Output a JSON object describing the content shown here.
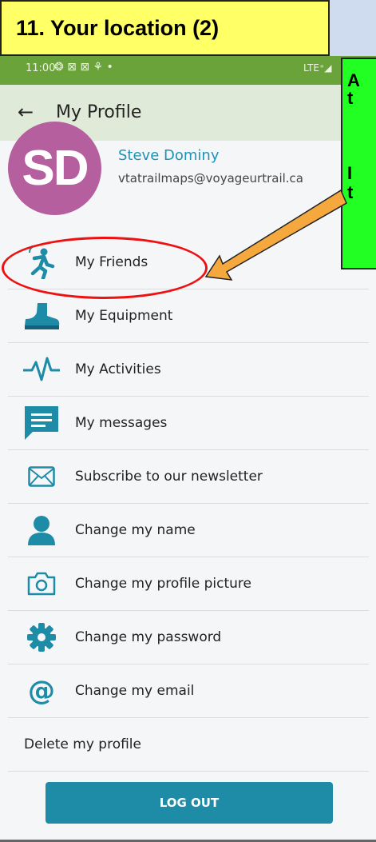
{
  "slide": {
    "title": "11. Your location (2)"
  },
  "callout": {
    "line1": "A",
    "line2": "t",
    "line3": "I",
    "line4": "t"
  },
  "status": {
    "time": "11:00",
    "icons": "❂ ⊠ ⊠ ⚘ •",
    "network": "LTE⁺◢"
  },
  "appbar": {
    "back": "←",
    "title": "My Profile"
  },
  "profile": {
    "initials": "SD",
    "name": "Steve Dominy",
    "email": "vtatrailmaps@voyageurtrail.ca"
  },
  "menu": [
    {
      "label": "My Friends",
      "icon": "runner-icon"
    },
    {
      "label": "My Equipment",
      "icon": "boot-icon"
    },
    {
      "label": "My Activities",
      "icon": "pulse-icon"
    },
    {
      "label": "My messages",
      "icon": "message-icon"
    },
    {
      "label": "Subscribe to our newsletter",
      "icon": "envelope-icon"
    },
    {
      "label": "Change my name",
      "icon": "person-icon"
    },
    {
      "label": "Change my profile picture",
      "icon": "camera-icon"
    },
    {
      "label": "Change my password",
      "icon": "gear-icon"
    },
    {
      "label": "Change my email",
      "icon": "at-icon"
    },
    {
      "label": "Delete my profile",
      "icon": ""
    }
  ],
  "logout": "LOG OUT",
  "colors": {
    "accent": "#1e8ba7",
    "status_bar": "#6aa33a",
    "avatar": "#b55f9e"
  }
}
